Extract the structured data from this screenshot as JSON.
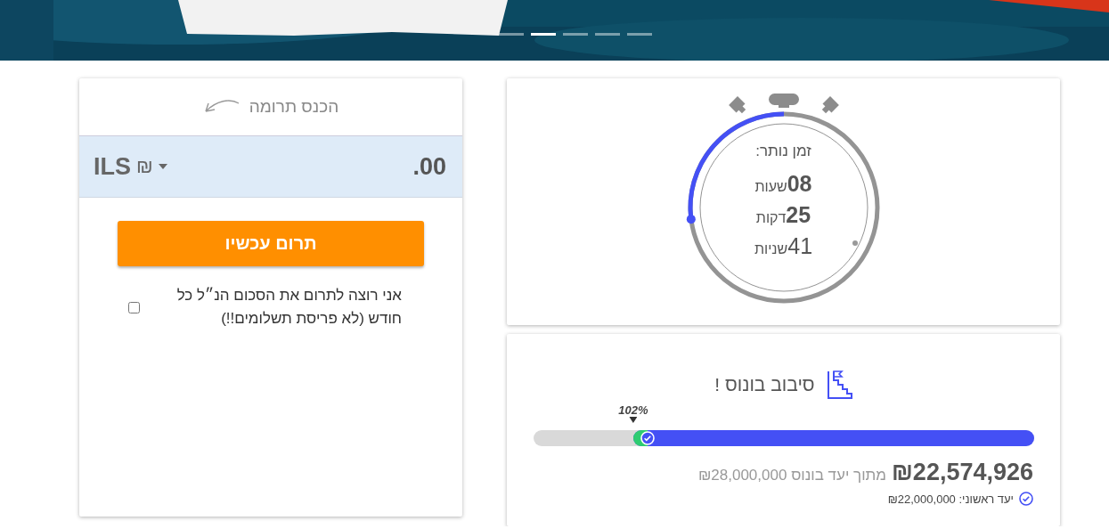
{
  "banner": {
    "kind": "picture",
    "indicators": [
      {
        "selected": false
      },
      {
        "selected": true
      },
      {
        "selected": false
      },
      {
        "selected": false
      },
      {
        "selected": false
      }
    ]
  },
  "timer": {
    "label": "זמן נותר:",
    "units": [
      {
        "value": "08",
        "unit": "שעות",
        "kind": "strong"
      },
      {
        "value": "25",
        "unit": "דקות",
        "kind": "strong"
      },
      {
        "value": "41",
        "unit": "שניות",
        "kind": "plain"
      }
    ]
  },
  "bonus": {
    "title": "סיבוב בונוס !",
    "percent": "102%",
    "level": 0.8,
    "amount": "₪22,574,926",
    "goal_text": "מתוך יעד בונוס ₪28,000,000",
    "first_goal": "יעד ראשוני: ₪22,000,000"
  },
  "donate": {
    "title": "הכנס תרומה",
    "amount": ".00",
    "currency": {
      "code": "ILS",
      "symbol": "₪"
    },
    "button": "תרום עכשיו",
    "monthly": {
      "label": "אני רוצה לתרום את הסכום הנ״ל כל חודש (לא פריסת תשלומים!!)",
      "checked": false
    }
  }
}
